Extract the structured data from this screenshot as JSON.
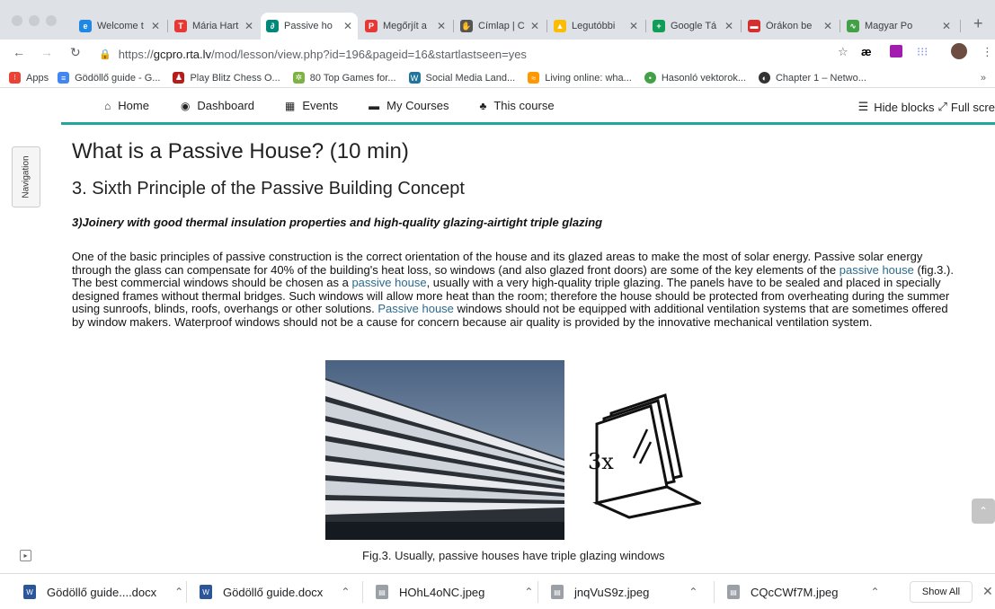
{
  "browser": {
    "tabs": [
      {
        "title": "Welcome t",
        "icon": "edge-icon",
        "color": "#1e88e5"
      },
      {
        "title": "Mária Hart",
        "icon": "it-logo-icon",
        "color": "#e53935"
      },
      {
        "title": "Passive ho",
        "icon": "app-icon",
        "color": "#00897b"
      },
      {
        "title": "Megőrjít a",
        "icon": "p-logo-icon",
        "color": "#e53935"
      },
      {
        "title": "Címlap | C",
        "icon": "hand-icon",
        "color": "#555555"
      },
      {
        "title": "Legutóbbi",
        "icon": "drive-icon",
        "color": "#fbbc04"
      },
      {
        "title": "Google Tá",
        "icon": "sheets-icon",
        "color": "#0f9d58"
      },
      {
        "title": "Órákon be",
        "icon": "app-icon",
        "color": "#d32f2f"
      },
      {
        "title": "Magyar Po",
        "icon": "wave-icon",
        "color": "#43a047"
      }
    ],
    "new_tab": "+",
    "url": {
      "scheme": "https://",
      "host": "gcpro.rta.lv",
      "path": "/mod/lesson/view.php?id=196&pageid=16&startlastseen=yes"
    },
    "bookmarks": [
      {
        "label": "Apps",
        "color": "#ea4335"
      },
      {
        "label": "Gödöllő guide - G...",
        "color": "#4285f4"
      },
      {
        "label": "Play Blitz Chess O...",
        "color": "#b71c1c"
      },
      {
        "label": "80 Top Games for...",
        "color": "#7cb342"
      },
      {
        "label": "Social Media Land...",
        "color": "#21759b"
      },
      {
        "label": "Living online: wha...",
        "color": "#ff9800"
      },
      {
        "label": "Hasonló vektorok...",
        "color": "#43a047"
      },
      {
        "label": "Chapter 1 – Netwo...",
        "color": "#333333"
      }
    ],
    "bookmarks_more": "»"
  },
  "moodle": {
    "nav": [
      {
        "label": "Home",
        "icon": "home-icon"
      },
      {
        "label": "Dashboard",
        "icon": "dashboard-icon"
      },
      {
        "label": "Events",
        "icon": "calendar-icon"
      },
      {
        "label": "My Courses",
        "icon": "courses-icon"
      },
      {
        "label": "This course",
        "icon": "sitemap-icon"
      }
    ],
    "hide_blocks": "Hide blocks",
    "full_screen": "Full scre",
    "side_tab": "Navigation"
  },
  "page": {
    "title": "What is a Passive House? (10 min)",
    "subtitle": "3. Sixth Principle of the Passive Building Concept",
    "section": "3)Joinery with good thermal insulation properties and high-quality glazing-airtight triple glazing",
    "p1": "One of the basic principles of passive construction is the correct orientation of the house and its glazed areas to make the most of solar energy. Passive solar energy through the glass can compensate for 40% of the building's heat loss, so windows (and also glazed front doors) are some of the key elements of the ",
    "link1": "passive house",
    "p2": " (fig.3.). The best commercial windows should be chosen as a ",
    "link2": "passive house",
    "p3": ", usually with a very high-quality triple glazing. The panels have to be sealed and placed in specially designed frames without thermal bridges. Such windows will allow more heat than the room; therefore the house should be protected from overheating during the summer using sunroofs, blinds, roofs, overhangs or other solutions. ",
    "link3": "Passive house",
    "p4": " windows should not be equipped with additional ventilation systems that are sometimes offered by window makers. Waterproof windows should not be a cause for concern because air quality is provided by the innovative mechanical ventilation system.",
    "icon_label": "3x",
    "caption": "Fig.3. Usually, passive houses have triple glazing windows"
  },
  "downloads": {
    "items": [
      {
        "name": "Gödöllő guide....docx",
        "type": "word"
      },
      {
        "name": "Gödöllő guide.docx",
        "type": "word"
      },
      {
        "name": "HOhL4oNC.jpeg",
        "type": "image"
      },
      {
        "name": "jnqVuS9z.jpeg",
        "type": "image"
      },
      {
        "name": "CQcCWf7M.jpeg",
        "type": "image"
      }
    ],
    "show_all": "Show All"
  },
  "colors": {
    "accent": "#1fa79c",
    "link": "#2b6a8c"
  }
}
